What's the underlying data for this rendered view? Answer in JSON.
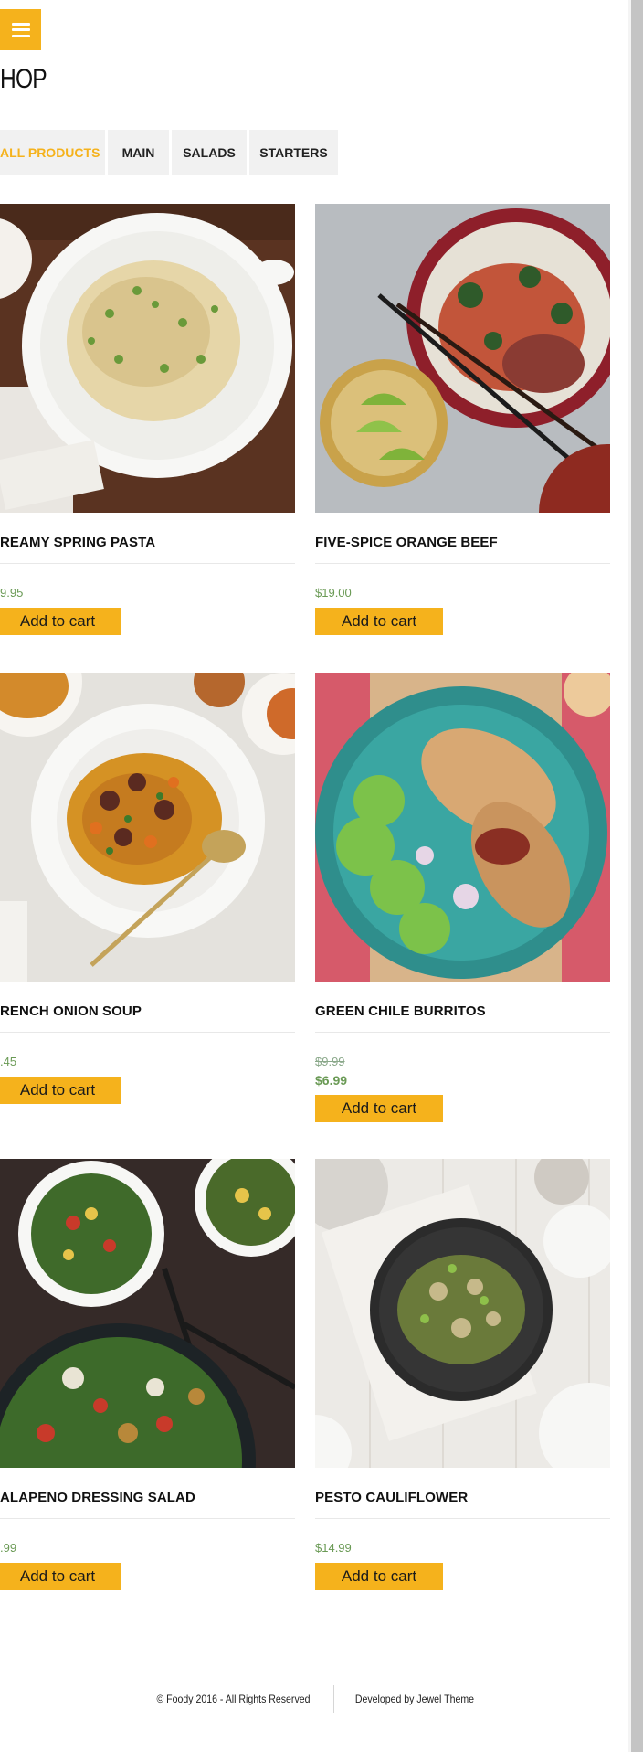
{
  "page": {
    "title": "HOP"
  },
  "filters": [
    {
      "label": "ALL PRODUCTS",
      "active": true
    },
    {
      "label": "MAIN",
      "active": false
    },
    {
      "label": "SALADS",
      "active": false
    },
    {
      "label": "STARTERS",
      "active": false
    }
  ],
  "products": [
    {
      "name": "REAMY SPRING PASTA",
      "price": "9.95",
      "cart_label": "Add to cart"
    },
    {
      "name": "FIVE-SPICE ORANGE BEEF",
      "price": "$19.00",
      "cart_label": "Add to cart"
    },
    {
      "name": "RENCH ONION SOUP",
      "price": ".45",
      "cart_label": "Add to cart"
    },
    {
      "name": "GREEN CHILE BURRITOS",
      "old_price": "$9.99",
      "price": "$6.99",
      "cart_label": "Add to cart"
    },
    {
      "name": "ALAPENO DRESSING SALAD",
      "price": ".99",
      "cart_label": "Add to cart"
    },
    {
      "name": "PESTO CAULIFLOWER",
      "price": "$14.99",
      "cart_label": "Add to cart"
    }
  ],
  "footer": {
    "copyright": "© Foody 2016 - All Rights Reserved",
    "credit": "Developed by Jewel Theme"
  },
  "colors": {
    "accent": "#f5b21c",
    "price": "#6a9a55"
  },
  "icons": {
    "menu": "hamburger-icon"
  }
}
